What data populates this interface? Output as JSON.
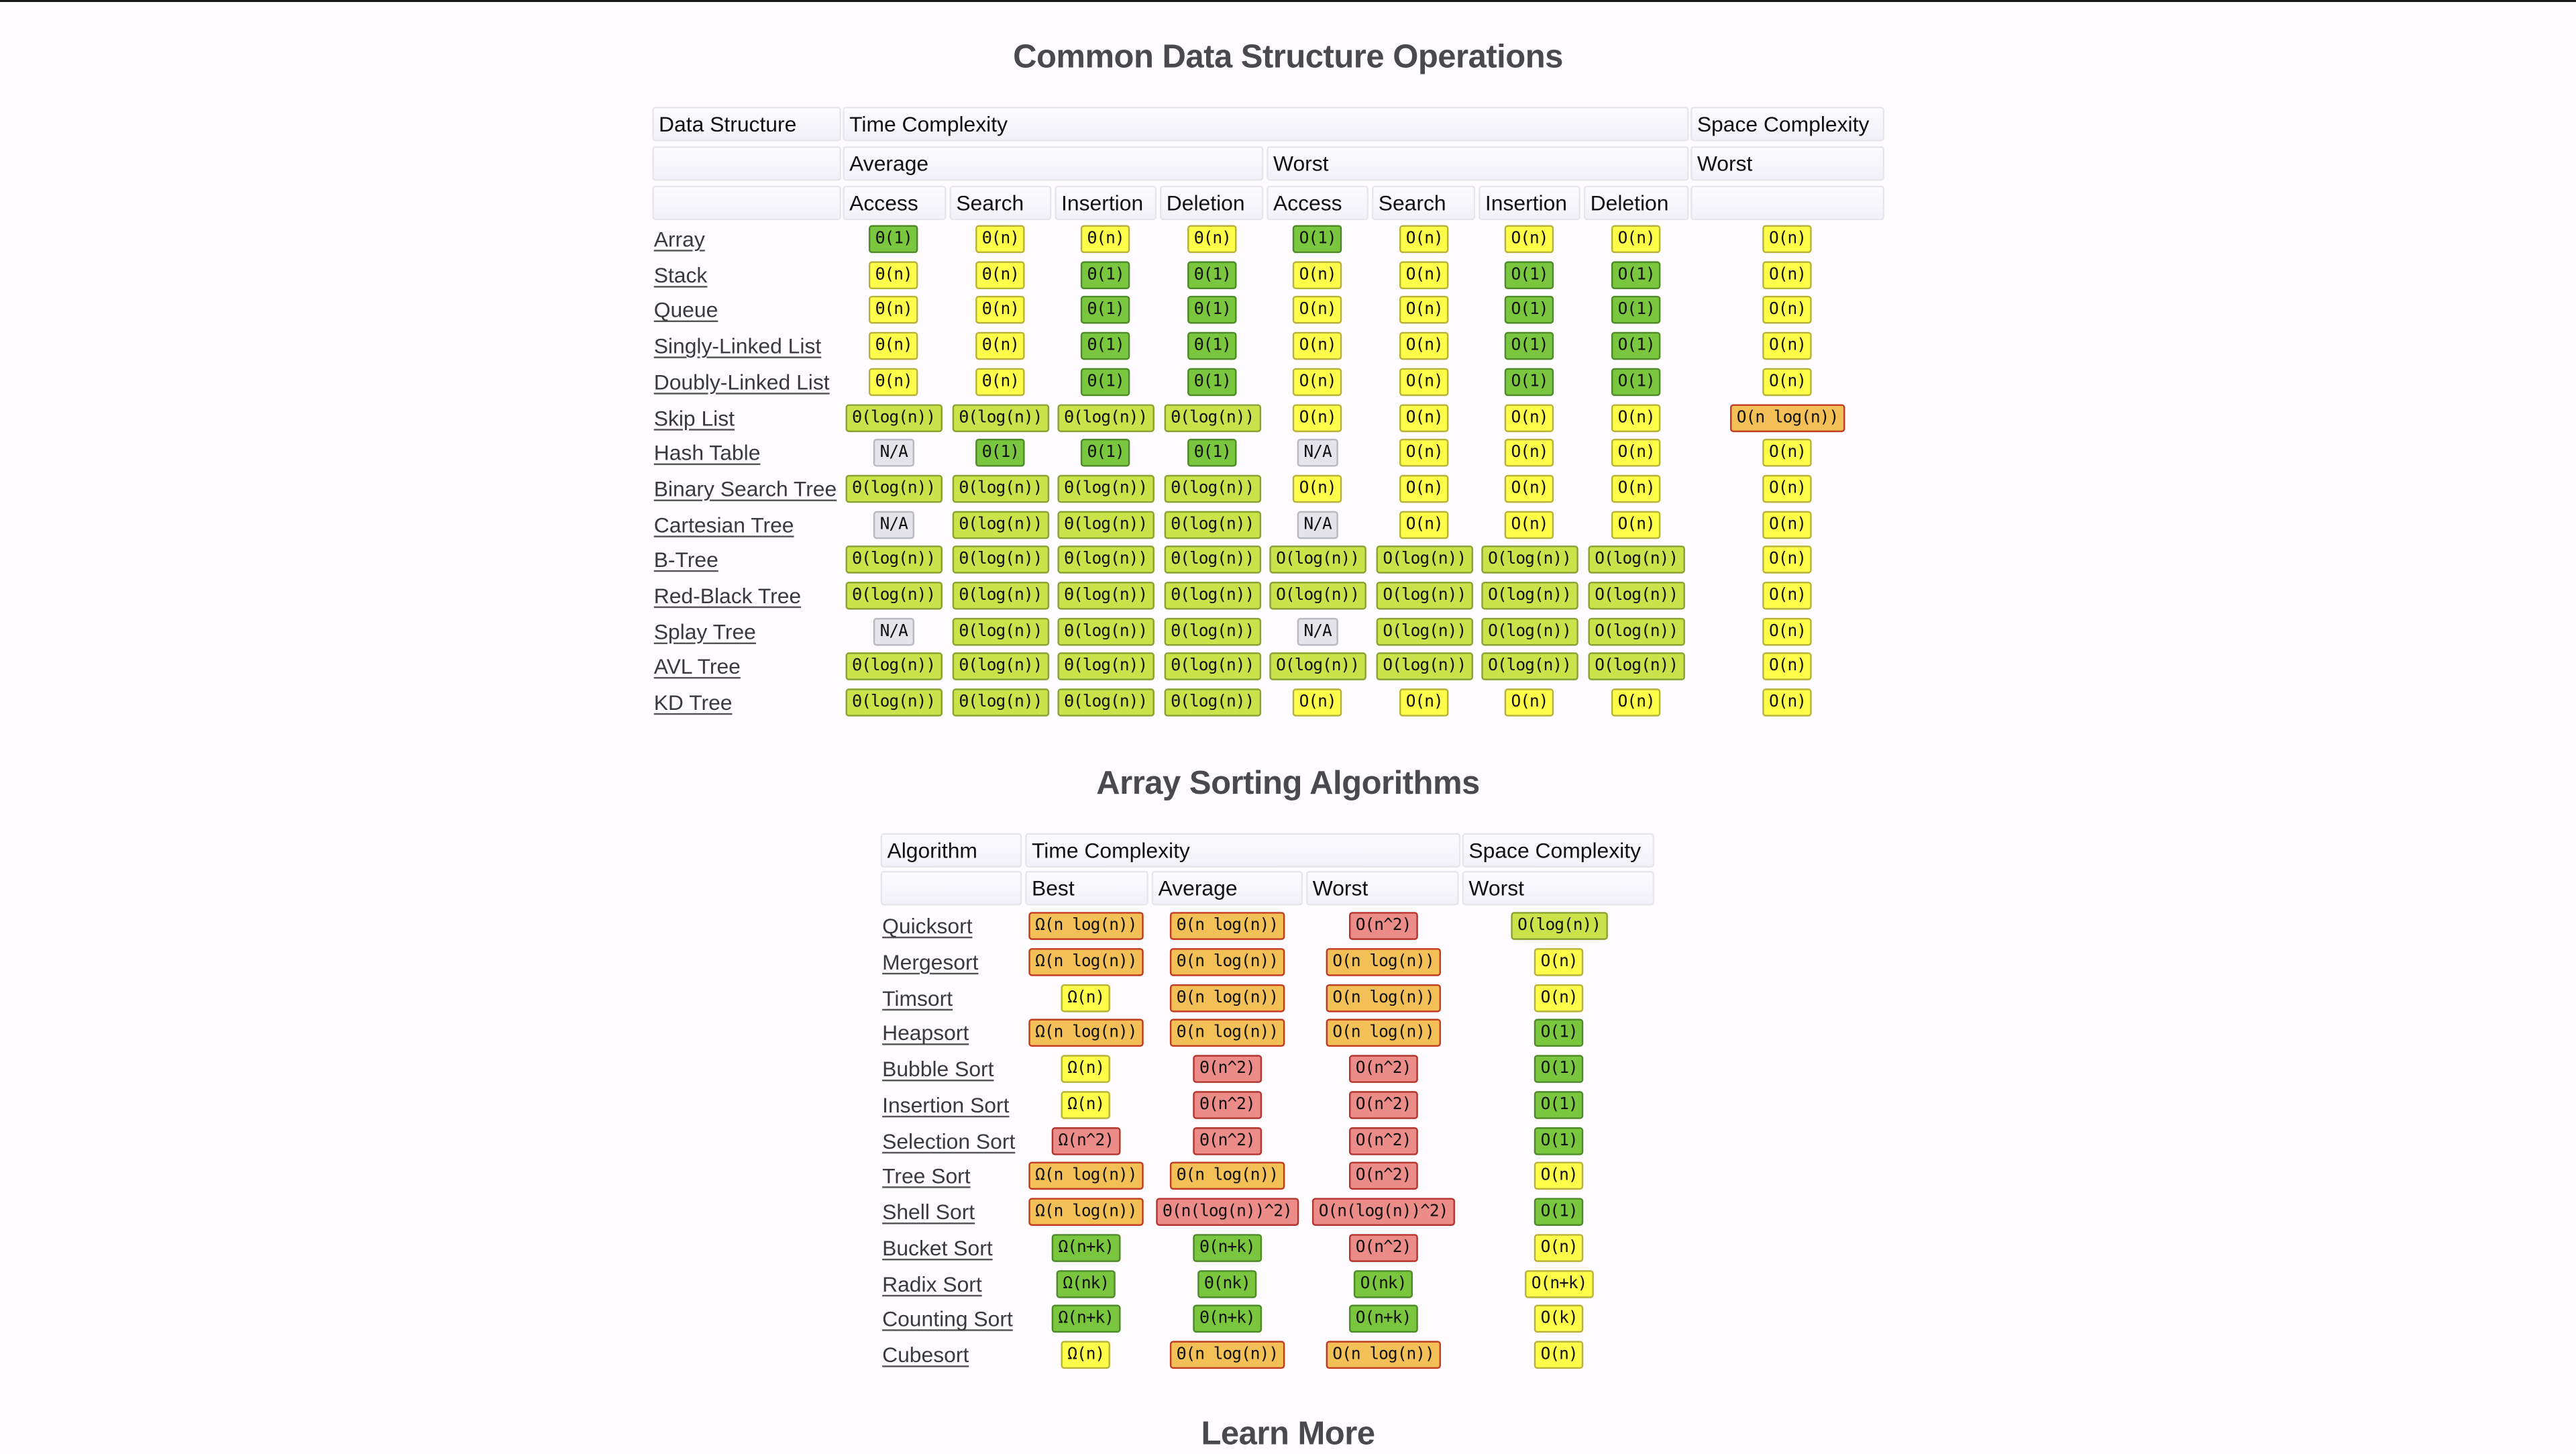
{
  "page": {
    "title_ds": "Common Data Structure Operations",
    "title_sort": "Array Sorting Algorithms",
    "title_learn": "Learn More"
  },
  "colors": {
    "excellent": "#7bc63f",
    "good": "#cbe34a",
    "fair": "#fefe4a",
    "bad": "#f3c057",
    "horrible": "#ec8c88",
    "na": "#e4e4ea"
  },
  "ds_table": {
    "headers": {
      "data_structure": "Data Structure",
      "time_complexity": "Time Complexity",
      "space_complexity": "Space Complexity",
      "average": "Average",
      "worst": "Worst",
      "space_worst": "Worst",
      "ops": [
        "Access",
        "Search",
        "Insertion",
        "Deletion",
        "Access",
        "Search",
        "Insertion",
        "Deletion"
      ]
    },
    "rows": [
      {
        "name": "Array",
        "cells": [
          [
            "Θ(1)",
            "g"
          ],
          [
            "Θ(n)",
            "y"
          ],
          [
            "Θ(n)",
            "y"
          ],
          [
            "Θ(n)",
            "y"
          ],
          [
            "O(1)",
            "g"
          ],
          [
            "O(n)",
            "y"
          ],
          [
            "O(n)",
            "y"
          ],
          [
            "O(n)",
            "y"
          ],
          [
            "O(n)",
            "y"
          ]
        ]
      },
      {
        "name": "Stack",
        "cells": [
          [
            "Θ(n)",
            "y"
          ],
          [
            "Θ(n)",
            "y"
          ],
          [
            "Θ(1)",
            "g"
          ],
          [
            "Θ(1)",
            "g"
          ],
          [
            "O(n)",
            "y"
          ],
          [
            "O(n)",
            "y"
          ],
          [
            "O(1)",
            "g"
          ],
          [
            "O(1)",
            "g"
          ],
          [
            "O(n)",
            "y"
          ]
        ]
      },
      {
        "name": "Queue",
        "cells": [
          [
            "Θ(n)",
            "y"
          ],
          [
            "Θ(n)",
            "y"
          ],
          [
            "Θ(1)",
            "g"
          ],
          [
            "Θ(1)",
            "g"
          ],
          [
            "O(n)",
            "y"
          ],
          [
            "O(n)",
            "y"
          ],
          [
            "O(1)",
            "g"
          ],
          [
            "O(1)",
            "g"
          ],
          [
            "O(n)",
            "y"
          ]
        ]
      },
      {
        "name": "Singly-Linked List",
        "cells": [
          [
            "Θ(n)",
            "y"
          ],
          [
            "Θ(n)",
            "y"
          ],
          [
            "Θ(1)",
            "g"
          ],
          [
            "Θ(1)",
            "g"
          ],
          [
            "O(n)",
            "y"
          ],
          [
            "O(n)",
            "y"
          ],
          [
            "O(1)",
            "g"
          ],
          [
            "O(1)",
            "g"
          ],
          [
            "O(n)",
            "y"
          ]
        ]
      },
      {
        "name": "Doubly-Linked List",
        "cells": [
          [
            "Θ(n)",
            "y"
          ],
          [
            "Θ(n)",
            "y"
          ],
          [
            "Θ(1)",
            "g"
          ],
          [
            "Θ(1)",
            "g"
          ],
          [
            "O(n)",
            "y"
          ],
          [
            "O(n)",
            "y"
          ],
          [
            "O(1)",
            "g"
          ],
          [
            "O(1)",
            "g"
          ],
          [
            "O(n)",
            "y"
          ]
        ]
      },
      {
        "name": "Skip List",
        "cells": [
          [
            "Θ(log(n))",
            "lg"
          ],
          [
            "Θ(log(n))",
            "lg"
          ],
          [
            "Θ(log(n))",
            "lg"
          ],
          [
            "Θ(log(n))",
            "lg"
          ],
          [
            "O(n)",
            "y"
          ],
          [
            "O(n)",
            "y"
          ],
          [
            "O(n)",
            "y"
          ],
          [
            "O(n)",
            "y"
          ],
          [
            "O(n log(n))",
            "o"
          ]
        ]
      },
      {
        "name": "Hash Table",
        "cells": [
          [
            "N/A",
            "na"
          ],
          [
            "Θ(1)",
            "g"
          ],
          [
            "Θ(1)",
            "g"
          ],
          [
            "Θ(1)",
            "g"
          ],
          [
            "N/A",
            "na"
          ],
          [
            "O(n)",
            "y"
          ],
          [
            "O(n)",
            "y"
          ],
          [
            "O(n)",
            "y"
          ],
          [
            "O(n)",
            "y"
          ]
        ]
      },
      {
        "name": "Binary Search Tree",
        "cells": [
          [
            "Θ(log(n))",
            "lg"
          ],
          [
            "Θ(log(n))",
            "lg"
          ],
          [
            "Θ(log(n))",
            "lg"
          ],
          [
            "Θ(log(n))",
            "lg"
          ],
          [
            "O(n)",
            "y"
          ],
          [
            "O(n)",
            "y"
          ],
          [
            "O(n)",
            "y"
          ],
          [
            "O(n)",
            "y"
          ],
          [
            "O(n)",
            "y"
          ]
        ]
      },
      {
        "name": "Cartesian Tree",
        "cells": [
          [
            "N/A",
            "na"
          ],
          [
            "Θ(log(n))",
            "lg"
          ],
          [
            "Θ(log(n))",
            "lg"
          ],
          [
            "Θ(log(n))",
            "lg"
          ],
          [
            "N/A",
            "na"
          ],
          [
            "O(n)",
            "y"
          ],
          [
            "O(n)",
            "y"
          ],
          [
            "O(n)",
            "y"
          ],
          [
            "O(n)",
            "y"
          ]
        ]
      },
      {
        "name": "B-Tree",
        "cells": [
          [
            "Θ(log(n))",
            "lg"
          ],
          [
            "Θ(log(n))",
            "lg"
          ],
          [
            "Θ(log(n))",
            "lg"
          ],
          [
            "Θ(log(n))",
            "lg"
          ],
          [
            "O(log(n))",
            "lg"
          ],
          [
            "O(log(n))",
            "lg"
          ],
          [
            "O(log(n))",
            "lg"
          ],
          [
            "O(log(n))",
            "lg"
          ],
          [
            "O(n)",
            "y"
          ]
        ]
      },
      {
        "name": "Red-Black Tree",
        "cells": [
          [
            "Θ(log(n))",
            "lg"
          ],
          [
            "Θ(log(n))",
            "lg"
          ],
          [
            "Θ(log(n))",
            "lg"
          ],
          [
            "Θ(log(n))",
            "lg"
          ],
          [
            "O(log(n))",
            "lg"
          ],
          [
            "O(log(n))",
            "lg"
          ],
          [
            "O(log(n))",
            "lg"
          ],
          [
            "O(log(n))",
            "lg"
          ],
          [
            "O(n)",
            "y"
          ]
        ]
      },
      {
        "name": "Splay Tree",
        "cells": [
          [
            "N/A",
            "na"
          ],
          [
            "Θ(log(n))",
            "lg"
          ],
          [
            "Θ(log(n))",
            "lg"
          ],
          [
            "Θ(log(n))",
            "lg"
          ],
          [
            "N/A",
            "na"
          ],
          [
            "O(log(n))",
            "lg"
          ],
          [
            "O(log(n))",
            "lg"
          ],
          [
            "O(log(n))",
            "lg"
          ],
          [
            "O(n)",
            "y"
          ]
        ]
      },
      {
        "name": "AVL Tree",
        "cells": [
          [
            "Θ(log(n))",
            "lg"
          ],
          [
            "Θ(log(n))",
            "lg"
          ],
          [
            "Θ(log(n))",
            "lg"
          ],
          [
            "Θ(log(n))",
            "lg"
          ],
          [
            "O(log(n))",
            "lg"
          ],
          [
            "O(log(n))",
            "lg"
          ],
          [
            "O(log(n))",
            "lg"
          ],
          [
            "O(log(n))",
            "lg"
          ],
          [
            "O(n)",
            "y"
          ]
        ]
      },
      {
        "name": "KD Tree",
        "cells": [
          [
            "Θ(log(n))",
            "lg"
          ],
          [
            "Θ(log(n))",
            "lg"
          ],
          [
            "Θ(log(n))",
            "lg"
          ],
          [
            "Θ(log(n))",
            "lg"
          ],
          [
            "O(n)",
            "y"
          ],
          [
            "O(n)",
            "y"
          ],
          [
            "O(n)",
            "y"
          ],
          [
            "O(n)",
            "y"
          ],
          [
            "O(n)",
            "y"
          ]
        ]
      }
    ]
  },
  "sort_table": {
    "headers": {
      "algorithm": "Algorithm",
      "time_complexity": "Time Complexity",
      "space_complexity": "Space Complexity",
      "best": "Best",
      "average": "Average",
      "worst": "Worst",
      "space_worst": "Worst"
    },
    "rows": [
      {
        "name": "Quicksort",
        "cells": [
          [
            "Ω(n log(n))",
            "o"
          ],
          [
            "Θ(n log(n))",
            "o"
          ],
          [
            "O(n^2)",
            "r"
          ],
          [
            "O(log(n))",
            "lg"
          ]
        ]
      },
      {
        "name": "Mergesort",
        "cells": [
          [
            "Ω(n log(n))",
            "o"
          ],
          [
            "Θ(n log(n))",
            "o"
          ],
          [
            "O(n log(n))",
            "o"
          ],
          [
            "O(n)",
            "y"
          ]
        ]
      },
      {
        "name": "Timsort",
        "cells": [
          [
            "Ω(n)",
            "y"
          ],
          [
            "Θ(n log(n))",
            "o"
          ],
          [
            "O(n log(n))",
            "o"
          ],
          [
            "O(n)",
            "y"
          ]
        ]
      },
      {
        "name": "Heapsort",
        "cells": [
          [
            "Ω(n log(n))",
            "o"
          ],
          [
            "Θ(n log(n))",
            "o"
          ],
          [
            "O(n log(n))",
            "o"
          ],
          [
            "O(1)",
            "g"
          ]
        ]
      },
      {
        "name": "Bubble Sort",
        "cells": [
          [
            "Ω(n)",
            "y"
          ],
          [
            "Θ(n^2)",
            "r"
          ],
          [
            "O(n^2)",
            "r"
          ],
          [
            "O(1)",
            "g"
          ]
        ]
      },
      {
        "name": "Insertion Sort",
        "cells": [
          [
            "Ω(n)",
            "y"
          ],
          [
            "Θ(n^2)",
            "r"
          ],
          [
            "O(n^2)",
            "r"
          ],
          [
            "O(1)",
            "g"
          ]
        ]
      },
      {
        "name": "Selection Sort",
        "cells": [
          [
            "Ω(n^2)",
            "r"
          ],
          [
            "Θ(n^2)",
            "r"
          ],
          [
            "O(n^2)",
            "r"
          ],
          [
            "O(1)",
            "g"
          ]
        ]
      },
      {
        "name": "Tree Sort",
        "cells": [
          [
            "Ω(n log(n))",
            "o"
          ],
          [
            "Θ(n log(n))",
            "o"
          ],
          [
            "O(n^2)",
            "r"
          ],
          [
            "O(n)",
            "y"
          ]
        ]
      },
      {
        "name": "Shell Sort",
        "cells": [
          [
            "Ω(n log(n))",
            "o"
          ],
          [
            "Θ(n(log(n))^2)",
            "r"
          ],
          [
            "O(n(log(n))^2)",
            "r"
          ],
          [
            "O(1)",
            "g"
          ]
        ]
      },
      {
        "name": "Bucket Sort",
        "cells": [
          [
            "Ω(n+k)",
            "g"
          ],
          [
            "Θ(n+k)",
            "g"
          ],
          [
            "O(n^2)",
            "r"
          ],
          [
            "O(n)",
            "y"
          ]
        ]
      },
      {
        "name": "Radix Sort",
        "cells": [
          [
            "Ω(nk)",
            "g"
          ],
          [
            "Θ(nk)",
            "g"
          ],
          [
            "O(nk)",
            "g"
          ],
          [
            "O(n+k)",
            "y"
          ]
        ]
      },
      {
        "name": "Counting Sort",
        "cells": [
          [
            "Ω(n+k)",
            "g"
          ],
          [
            "Θ(n+k)",
            "g"
          ],
          [
            "O(n+k)",
            "g"
          ],
          [
            "O(k)",
            "y"
          ]
        ]
      },
      {
        "name": "Cubesort",
        "cells": [
          [
            "Ω(n)",
            "y"
          ],
          [
            "Θ(n log(n))",
            "o"
          ],
          [
            "O(n log(n))",
            "o"
          ],
          [
            "O(n)",
            "y"
          ]
        ]
      }
    ]
  }
}
